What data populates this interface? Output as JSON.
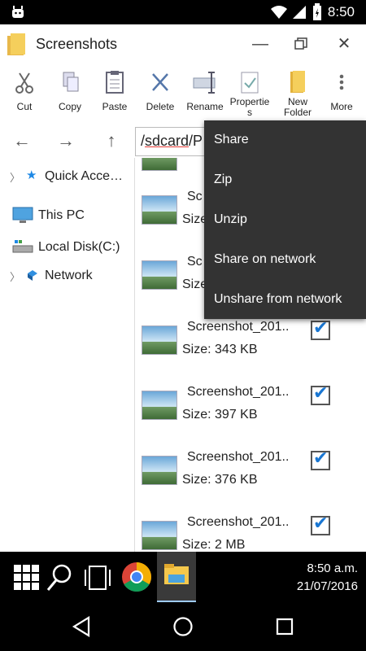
{
  "status_bar": {
    "time": "8:50"
  },
  "window": {
    "title": "Screenshots"
  },
  "toolbar": {
    "items": [
      {
        "label": "Cut",
        "icon": "scissors-icon"
      },
      {
        "label": "Copy",
        "icon": "copy-icon"
      },
      {
        "label": "Paste",
        "icon": "paste-icon"
      },
      {
        "label": "Delete",
        "icon": "delete-icon"
      },
      {
        "label": "Rename",
        "icon": "rename-icon"
      },
      {
        "label_line1": "Propertie",
        "label_line2": "s",
        "icon": "properties-icon"
      },
      {
        "label_line1": "New",
        "label_line2": "Folder",
        "icon": "new-folder-icon"
      },
      {
        "label": "More",
        "icon": "more-vertical-icon"
      }
    ]
  },
  "path": {
    "prefix": "/",
    "sdcard": "sdcard",
    "rest": "/P"
  },
  "sidebar": {
    "items": [
      {
        "label": "Quick Acce…"
      },
      {
        "label": "This PC"
      },
      {
        "label": "Local Disk(C:)"
      },
      {
        "label": "Network"
      }
    ]
  },
  "files": [
    {
      "name": "Sc",
      "size": "Size: "
    },
    {
      "name": "Sc",
      "size": "Size:"
    },
    {
      "name": "Screenshot_201..",
      "size": "Size: 343 KB"
    },
    {
      "name": "Screenshot_201..",
      "size": "Size: 397 KB"
    },
    {
      "name": "Screenshot_201..",
      "size": "Size: 376 KB"
    },
    {
      "name": "Screenshot_201..",
      "size": "Size: 2 MB"
    }
  ],
  "context_menu": {
    "items": [
      {
        "label": "Share"
      },
      {
        "label": "Zip"
      },
      {
        "label": "Unzip"
      },
      {
        "label": "Share on network"
      },
      {
        "label": "Unshare from network"
      }
    ]
  },
  "taskbar": {
    "time": "8:50 a.m.",
    "date": "21/07/2016"
  },
  "colors": {
    "accent": "#1976d2",
    "menu_bg": "#333333",
    "underline": "#e53935",
    "taskbar_active": "#3a3a3a"
  }
}
